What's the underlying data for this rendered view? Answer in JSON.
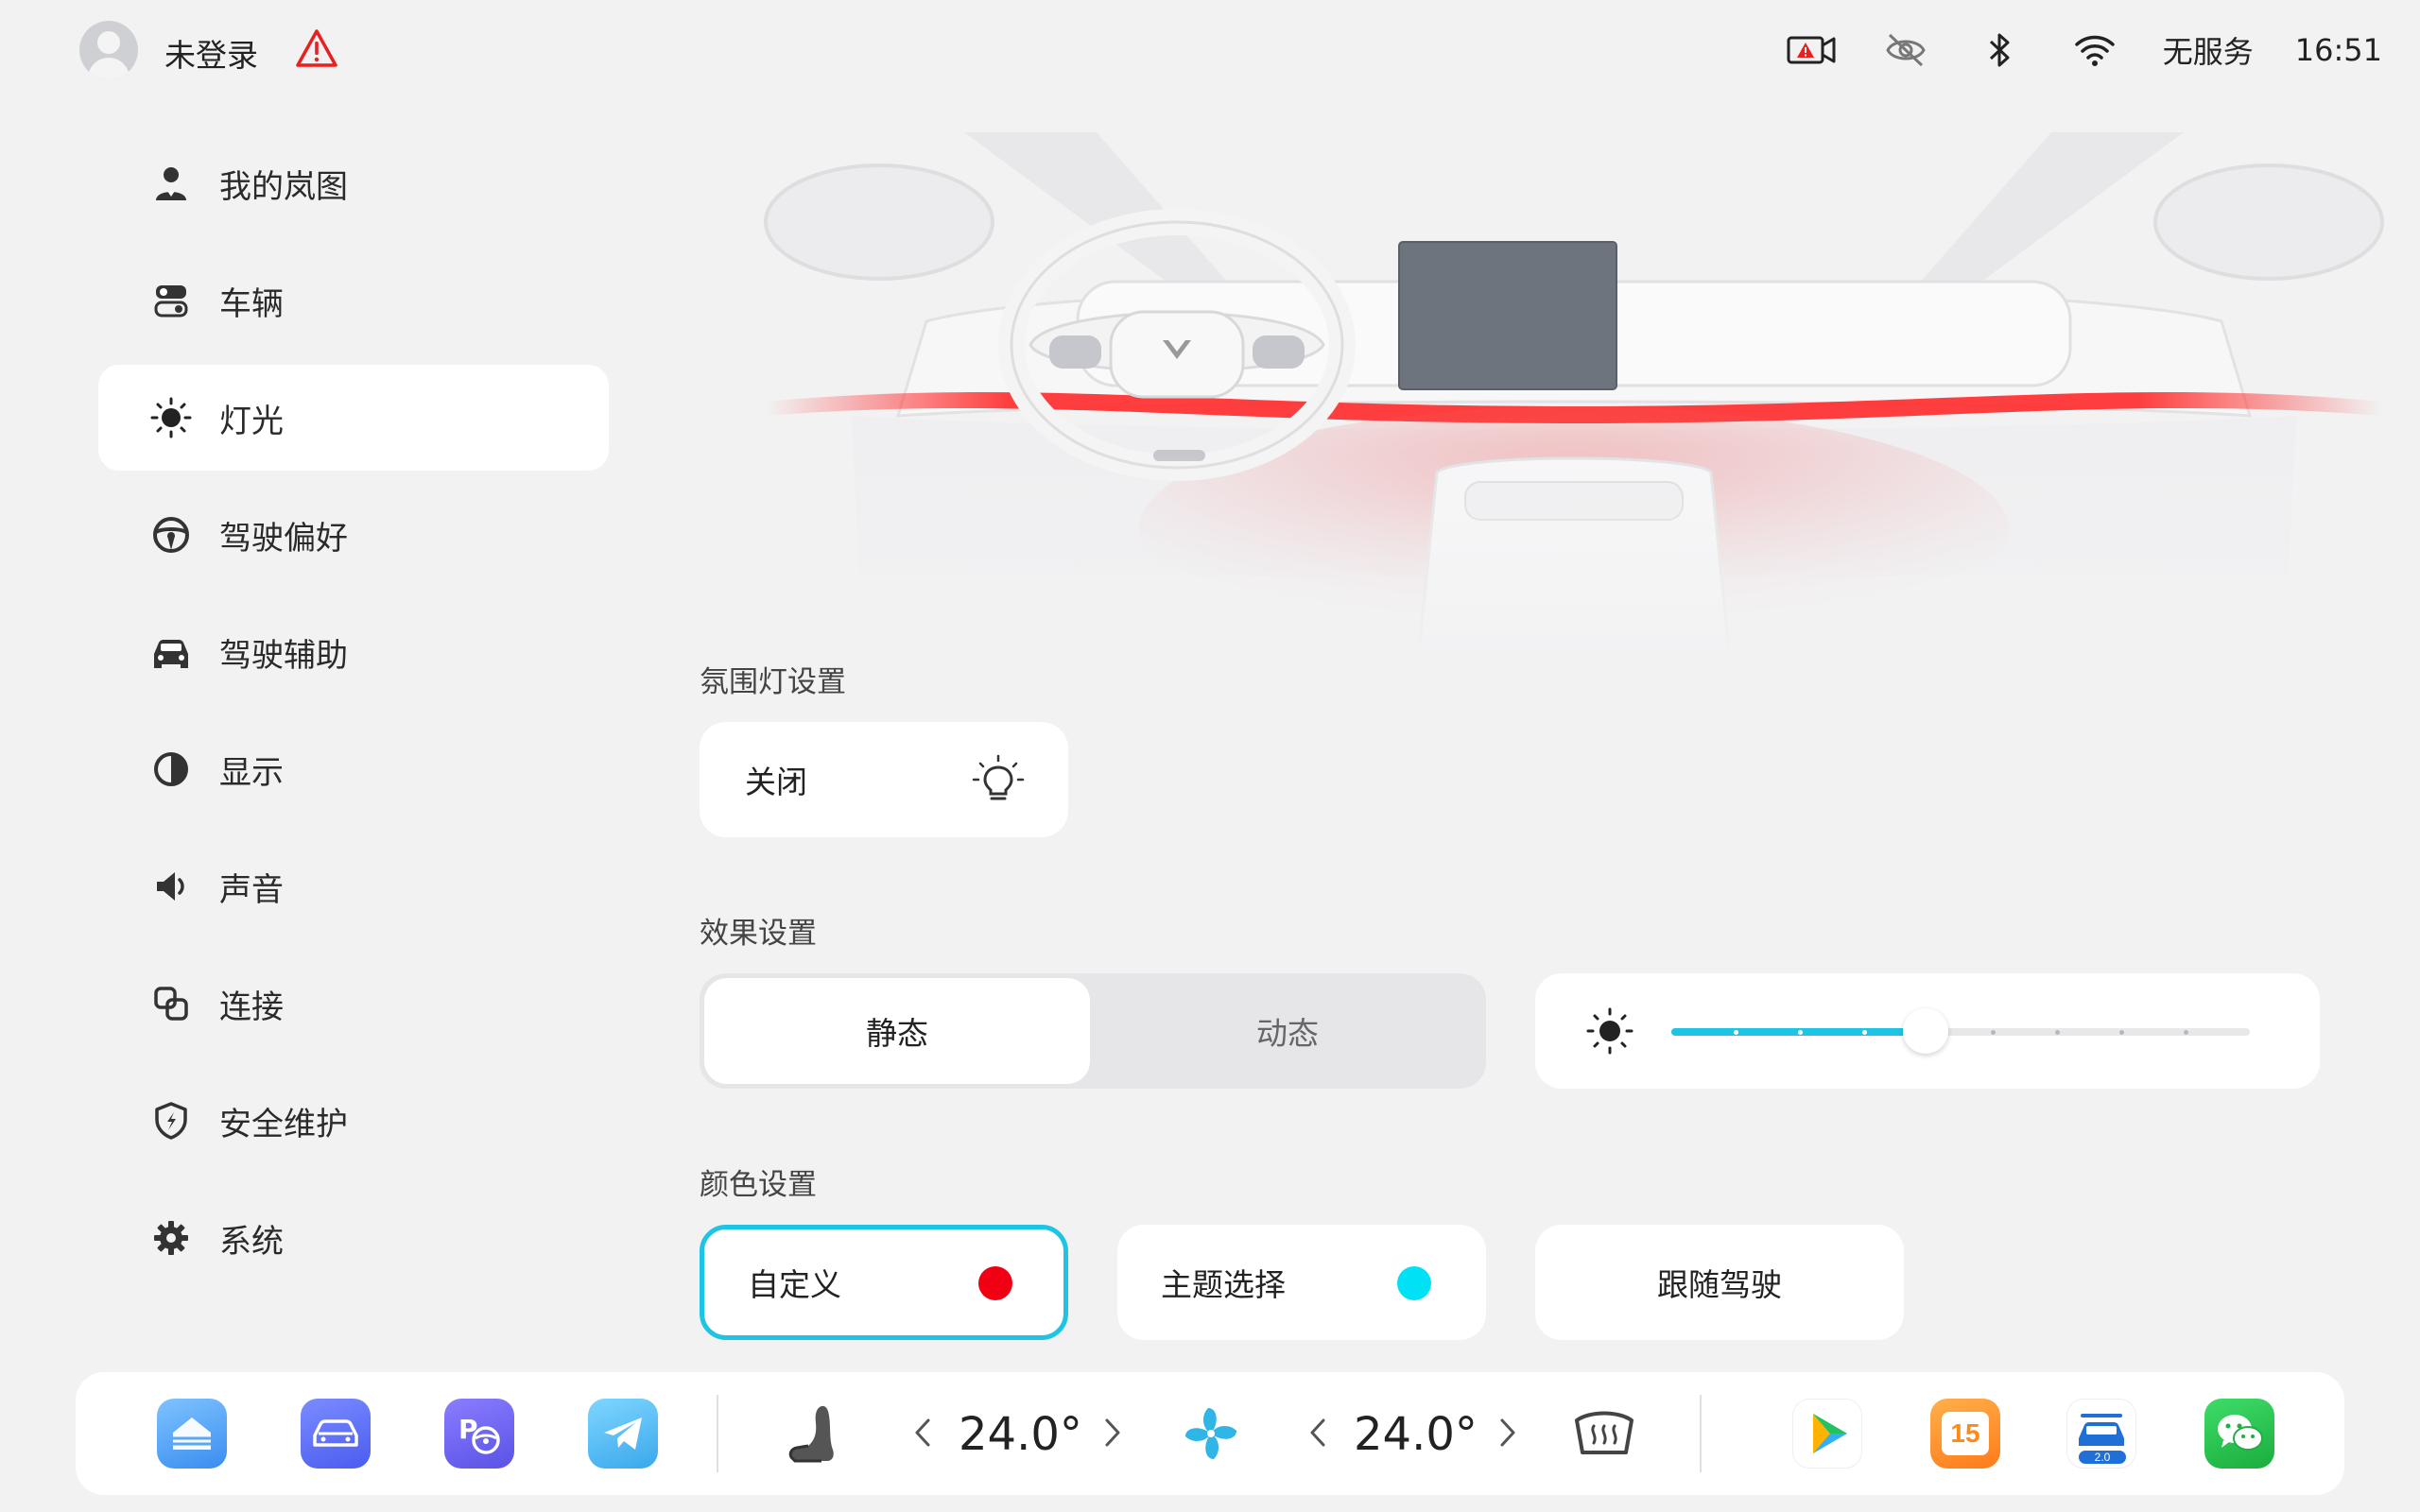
{
  "status_bar": {
    "login_label": "未登录",
    "network_label": "无服务",
    "time": "16:51",
    "icons": [
      "dashcam-warning-icon",
      "camera-off-icon",
      "bluetooth-icon",
      "wifi-icon"
    ]
  },
  "sidebar": {
    "items": [
      {
        "label": "我的岚图",
        "icon": "user-icon"
      },
      {
        "label": "车辆",
        "icon": "vehicle-toggle-icon"
      },
      {
        "label": "灯光",
        "icon": "light-icon",
        "active": true
      },
      {
        "label": "驾驶偏好",
        "icon": "steering-wheel-icon"
      },
      {
        "label": "驾驶辅助",
        "icon": "car-front-icon"
      },
      {
        "label": "显示",
        "icon": "contrast-icon"
      },
      {
        "label": "声音",
        "icon": "speaker-icon"
      },
      {
        "label": "连接",
        "icon": "link-icon"
      },
      {
        "label": "安全维护",
        "icon": "shield-icon"
      },
      {
        "label": "系统",
        "icon": "gear-icon"
      }
    ]
  },
  "ambient": {
    "section_title": "氛围灯设置",
    "state_label": "关闭",
    "state_icon": "bulb-icon"
  },
  "effect": {
    "section_title": "效果设置",
    "options": [
      "静态",
      "动态"
    ],
    "selected": "静态",
    "brightness_level": 0.44,
    "brightness_steps": 9
  },
  "color": {
    "section_title": "颜色设置",
    "custom_label": "自定义",
    "custom_color": "#f00012",
    "theme_label": "主题选择",
    "theme_color": "#00e1f6",
    "follow_label": "跟随驾驶",
    "selected": "自定义"
  },
  "dock": {
    "apps_left": [
      "home-app-icon",
      "vehicle-app-icon",
      "parking-app-icon",
      "telegram-app-icon"
    ],
    "left_temp": "24.0°",
    "right_temp": "24.0°",
    "apps_right": [
      "video-app-icon",
      "calendar-app-icon",
      "car-wash-app-icon",
      "wechat-app-icon"
    ],
    "calendar_day": "15",
    "car_wash_badge": "2.0"
  },
  "colors": {
    "accent": "#1ec4e4",
    "background": "#f2f2f3",
    "ambient_red": "#f00012"
  }
}
